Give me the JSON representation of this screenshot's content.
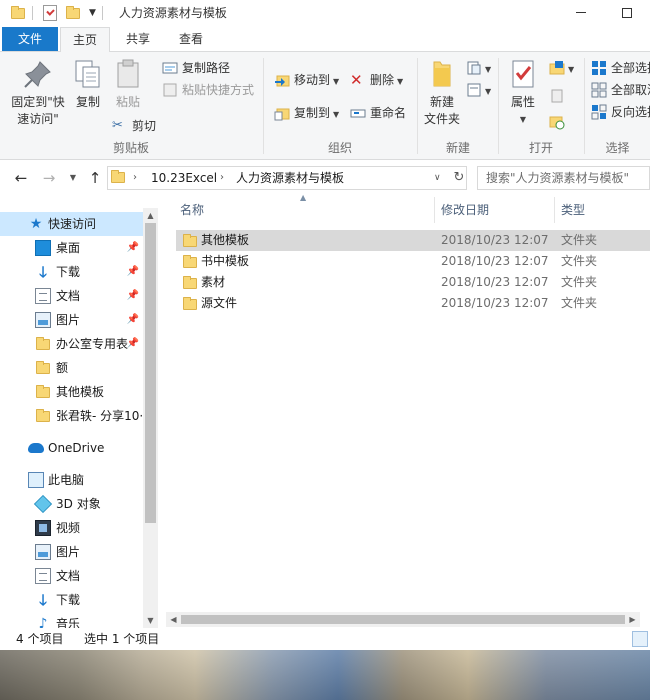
{
  "window": {
    "title": "人力资源素材与模板"
  },
  "tabs": [
    {
      "label": "文件"
    },
    {
      "label": "主页"
    },
    {
      "label": "共享"
    },
    {
      "label": "查看"
    }
  ],
  "ribbon": {
    "clipboard": {
      "pin_label_1": "固定到\"快",
      "pin_label_2": "速访问\"",
      "copy_label": "复制",
      "paste_label": "粘贴",
      "copy_path": "复制路径",
      "paste_shortcut": "粘贴快捷方式",
      "cut": "剪切",
      "group_label": "剪贴板"
    },
    "organize": {
      "move_to": "移动到",
      "copy_to": "复制到",
      "delete": "删除",
      "rename": "重命名",
      "group_label": "组织"
    },
    "new": {
      "new_folder_1": "新建",
      "new_folder_2": "文件夹",
      "group_label": "新建"
    },
    "open": {
      "properties": "属性",
      "group_label": "打开"
    },
    "select": {
      "select_all": "全部选择",
      "select_none": "全部取消",
      "invert": "反向选择",
      "group_label": "选择"
    }
  },
  "address": {
    "crumbs": [
      "10.23Excel",
      "人力资源素材与模板"
    ],
    "search_placeholder": "搜索\"人力资源素材与模板\""
  },
  "sidebar": {
    "items": [
      {
        "label": "快速访问",
        "icon": "star-icon",
        "selected": true
      },
      {
        "label": "桌面",
        "icon": "desktop-icon",
        "pinned": true
      },
      {
        "label": "下载",
        "icon": "download-icon",
        "pinned": true
      },
      {
        "label": "文档",
        "icon": "document-icon",
        "pinned": true
      },
      {
        "label": "图片",
        "icon": "picture-icon",
        "pinned": true
      },
      {
        "label": "办公室专用表",
        "icon": "folder-icon",
        "pinned": true
      },
      {
        "label": "额",
        "icon": "folder-icon"
      },
      {
        "label": "其他模板",
        "icon": "folder-icon"
      },
      {
        "label": "张君轶- 分享10·",
        "icon": "folder-icon"
      },
      {
        "label": "OneDrive",
        "icon": "cloud-icon"
      },
      {
        "label": "此电脑",
        "icon": "computer-icon"
      },
      {
        "label": "3D 对象",
        "icon": "cube-icon"
      },
      {
        "label": "视频",
        "icon": "video-icon"
      },
      {
        "label": "图片",
        "icon": "picture-icon"
      },
      {
        "label": "文档",
        "icon": "document-icon"
      },
      {
        "label": "下载",
        "icon": "download-icon"
      },
      {
        "label": "音乐",
        "icon": "music-icon"
      }
    ]
  },
  "files": {
    "columns": [
      "名称",
      "修改日期",
      "类型"
    ],
    "rows": [
      {
        "name": "其他模板",
        "date": "2018/10/23 12:07",
        "type": "文件夹",
        "selected": true
      },
      {
        "name": "书中模板",
        "date": "2018/10/23 12:07",
        "type": "文件夹"
      },
      {
        "name": "素材",
        "date": "2018/10/23 12:07",
        "type": "文件夹"
      },
      {
        "name": "源文件",
        "date": "2018/10/23 12:07",
        "type": "文件夹"
      }
    ]
  },
  "status": {
    "count": "4 个项目",
    "selected": "选中 1 个项目"
  },
  "colors": {
    "accent": "#1979ca",
    "selection": "#cce8ff",
    "row_selection": "#d9d9d9",
    "folder": "#f8d775"
  }
}
